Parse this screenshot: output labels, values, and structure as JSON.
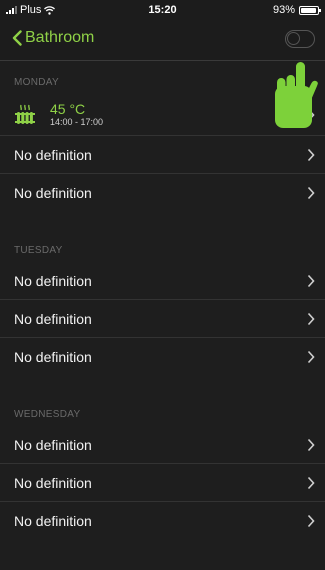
{
  "status": {
    "carrier": "Plus",
    "time": "15:20",
    "battery": "93%",
    "battery_level": 0.93
  },
  "nav": {
    "back_label": "Bathroom",
    "toggle_on": false
  },
  "colors": {
    "accent": "#8fd147",
    "background": "#1e1e1e",
    "separator": "#333333",
    "header_text": "#6a6a6a"
  },
  "sections": [
    {
      "day": "MONDAY",
      "rows": [
        {
          "icon": "radiator-icon",
          "temperature": "45 °C",
          "time_range": "14:00 - 17:00"
        },
        {
          "label": "No definition"
        },
        {
          "label": "No definition"
        }
      ]
    },
    {
      "day": "TUESDAY",
      "rows": [
        {
          "label": "No definition"
        },
        {
          "label": "No definition"
        },
        {
          "label": "No definition"
        }
      ]
    },
    {
      "day": "WEDNESDAY",
      "rows": [
        {
          "label": "No definition"
        },
        {
          "label": "No definition"
        },
        {
          "label": "No definition"
        }
      ]
    }
  ],
  "overlay": {
    "icon": "pointing-hand-icon"
  }
}
